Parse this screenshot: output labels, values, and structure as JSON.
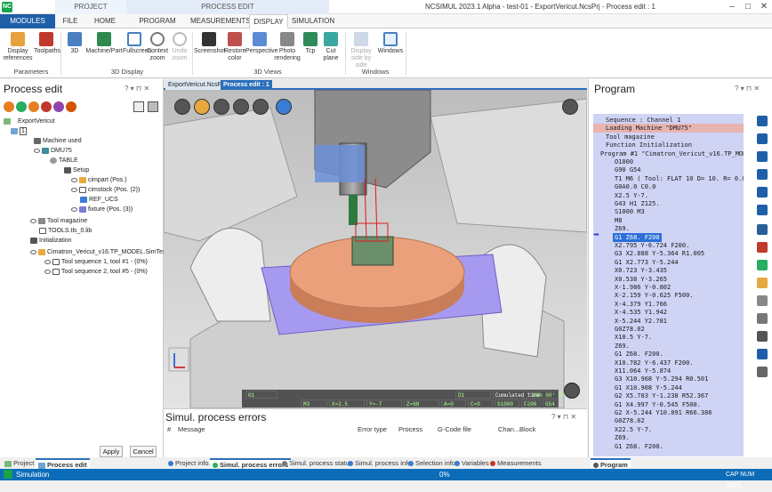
{
  "titlebar": {
    "logo": "NC",
    "ctx_project": "PROJECT",
    "ctx_process_edit": "PROCESS EDIT",
    "title": "NCSIMUL 2023.1 Alpha - test-01 - ExportVericut.NcsPrj - Process edit : 1"
  },
  "tabs": [
    "MODULES",
    "FILE",
    "HOME",
    "PROGRAM",
    "MEASUREMENTS",
    "DISPLAY",
    "SIMULATION"
  ],
  "ribbon": {
    "groups": [
      "Parameters",
      "3D Display",
      "3D Views",
      "Windows"
    ],
    "buttons": [
      {
        "label": "Display references"
      },
      {
        "label": "Toolpaths"
      },
      {
        "label": "3D"
      },
      {
        "label": "Machine/Part"
      },
      {
        "label": "Fullscreen"
      },
      {
        "label": "Context zoom"
      },
      {
        "label": "Undo zoom"
      },
      {
        "label": "Screenshot"
      },
      {
        "label": "Restore color"
      },
      {
        "label": "Perspective"
      },
      {
        "label": "Photo rendering"
      },
      {
        "label": "Tcp"
      },
      {
        "label": "Cut plane"
      },
      {
        "label": "Display side by side"
      },
      {
        "label": "Windows"
      }
    ]
  },
  "left_panel": {
    "title": "Process edit",
    "tree": [
      {
        "label": "ExportVericut"
      },
      {
        "label": "1"
      },
      {
        "label": "Machine used"
      },
      {
        "label": "DMU75"
      },
      {
        "label": "TABLE"
      },
      {
        "label": "Setup"
      },
      {
        "label": "cimpart (Pos.)"
      },
      {
        "label": "cimstock (Pos. (2))"
      },
      {
        "label": "REF_UCS"
      },
      {
        "label": "fixture (Pos. (3))"
      },
      {
        "label": "Tool magazine"
      },
      {
        "label": "TOOLS.tls_0.lib"
      },
      {
        "label": "Initialization"
      },
      {
        "label": "Cimatron_Vericut_v16.TP_MODEL.SimTest_"
      },
      {
        "label": "Tool sequence 1, tool #1 - (0%)"
      },
      {
        "label": "Tool sequence 2, tool #5 - (0%)"
      }
    ],
    "apply": "Apply",
    "cancel": "Cancel"
  },
  "doc_tabs": [
    "ExportVericut.NcsPrj",
    "Process edit : 1"
  ],
  "viewport": {
    "coords": {
      "g": "G1",
      "d": "D1",
      "cumulated_label": "Cumulated time",
      "cumulated": "00h 00' 02\"",
      "m": "M3",
      "x": "X=2.5",
      "y": "Y=-7",
      "z": "Z=68",
      "a": "A=0",
      "c": "C=0",
      "s": "S1000",
      "f": "F200",
      "g54": "G54"
    }
  },
  "errors": {
    "title": "Simul. process errors",
    "columns": [
      "#",
      "Message",
      "Error type",
      "Process",
      "G-Code file",
      "Chan...",
      "Block"
    ]
  },
  "bottom_tabs_left": [
    "Project",
    "Process edit"
  ],
  "bottom_tabs_center": [
    "Project info.",
    "Simul. process errors",
    "Simul. process status",
    "Simul. process info",
    "Selection info",
    "Variables",
    "Measurements"
  ],
  "program": {
    "title": "Program",
    "lines": [
      "Sequence : Channel 1",
      "Loading Machine \"DMU75\"",
      "Tool magazine",
      "Function Initialization",
      "Program #1 \"Cimatron_Vericut_v16.TP_MODEL",
      "O1000",
      "G90 G54",
      "T1 M6 ( Tool: FLAT 10 D= 10. R= 0.0)",
      "G0A0.0 C0.0",
      "X2.5 Y-7.",
      "G43 H1 Z125.",
      "S1000 M3",
      "M8",
      "Z69.",
      "G1 Z68. F200",
      "X2.795 Y-6.724 F200.",
      "G3 X2.888 Y-5.364 R1.005",
      "G1 X2.773 Y-5.244",
      "X0.723 Y-3.435",
      "X0.538 Y-3.265",
      "X-1.986 Y-0.802",
      "X-2.159 Y-0.625 F500.",
      "X-4.379 Y1.766",
      "X-4.535 Y1.942",
      "X-5.244 Y2.781",
      "G0Z78.02",
      "X10.5 Y-7.",
      "Z69.",
      "G1 Z68. F200.",
      "X10.782 Y-6.437 F200.",
      "X11.064 Y-5.874",
      "G3 X10.968 Y-5.294 R0.501",
      "G1 X10.908 Y-5.244",
      "G2 X5.783 Y-1.238 R52.367",
      "G1 X4.997 Y-0.545 F500.",
      "G2 X-5.244 Y10.891 R66.386",
      "G0Z78.02",
      "X22.5 Y-7.",
      "Z69.",
      "G1 Z68. F200."
    ]
  },
  "bottom_tab_right": "Program",
  "status": {
    "left": "Simulation",
    "center": "0%",
    "right": "CAP NUM SCRL"
  }
}
